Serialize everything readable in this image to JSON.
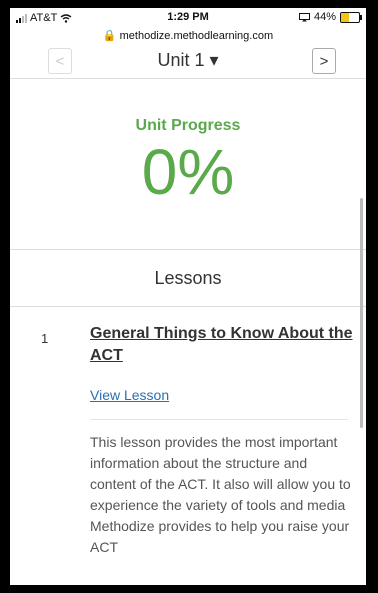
{
  "status_bar": {
    "carrier": "AT&T",
    "time": "1:29 PM",
    "battery_percent": "44%",
    "battery_level": 0.44
  },
  "browser": {
    "url": "methodize.methodlearning.com"
  },
  "unit_nav": {
    "prev_symbol": "<",
    "title": "Unit 1 ▾",
    "next_symbol": ">"
  },
  "progress": {
    "label": "Unit Progress",
    "value": "0%"
  },
  "lessons": {
    "heading": "Lessons",
    "items": [
      {
        "number": "1",
        "title": "General Things to Know About the ACT",
        "link": "View Lesson",
        "description": "This lesson provides the most important information about the structure and content of the ACT. It also will allow you to experience the variety of tools and media Methodize provides to help you raise your ACT"
      }
    ]
  },
  "colors": {
    "progress_green": "#5aa94b",
    "link_blue": "#2a6fb3",
    "battery_yellow": "#f0c419"
  }
}
